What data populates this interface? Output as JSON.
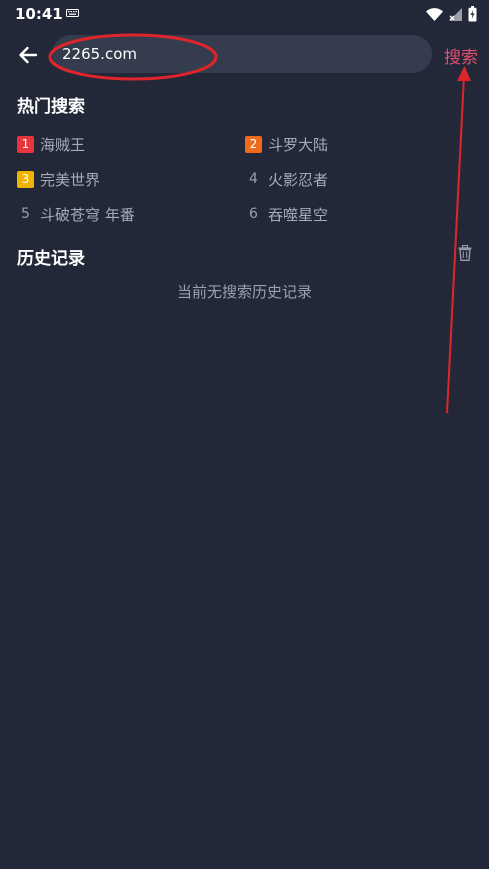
{
  "status_bar": {
    "time": "10:41"
  },
  "search": {
    "value": "2265.com",
    "button_label": "搜索"
  },
  "hot_search": {
    "title": "热门搜索",
    "items": [
      {
        "rank": "1",
        "label": "海贼王",
        "badge_color": "#e8353a"
      },
      {
        "rank": "2",
        "label": "斗罗大陆",
        "badge_color": "#f06a1c"
      },
      {
        "rank": "3",
        "label": "完美世界",
        "badge_color": "#f0b400"
      },
      {
        "rank": "4",
        "label": "火影忍者"
      },
      {
        "rank": "5",
        "label": "斗破苍穹 年番"
      },
      {
        "rank": "6",
        "label": "吞噬星空"
      }
    ]
  },
  "history": {
    "title": "历史记录",
    "empty_text": "当前无搜索历史记录"
  },
  "colors": {
    "background": "#222838",
    "search_box": "#353c4e",
    "accent": "#e24d6e",
    "annotation": "#e0252a"
  },
  "icons": {
    "back": "arrow-left-icon",
    "trash": "trash-icon",
    "keyboard": "keyboard-icon",
    "wifi": "wifi-icon",
    "signal": "signal-icon",
    "battery": "battery-icon"
  }
}
